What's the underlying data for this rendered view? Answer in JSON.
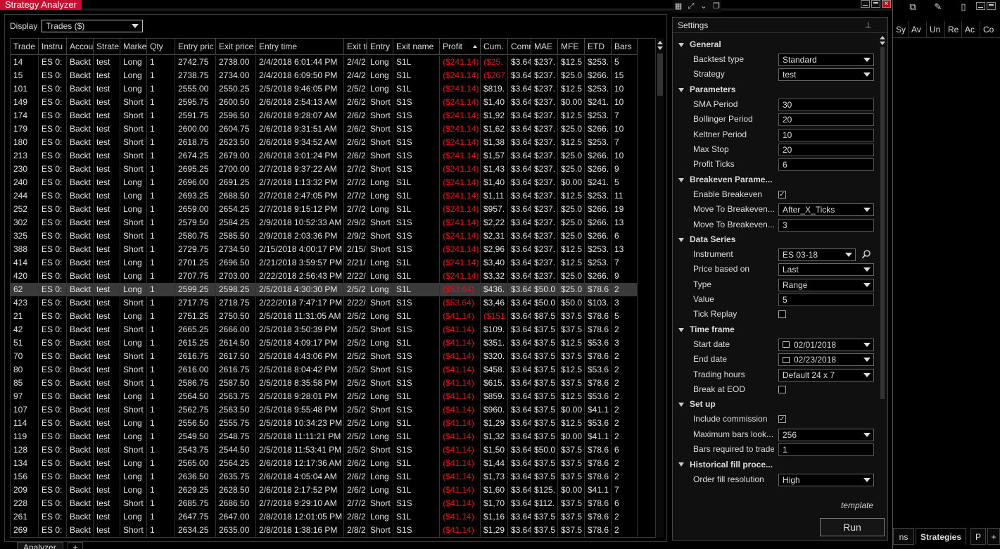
{
  "window": {
    "title": "Strategy Analyzer"
  },
  "display": {
    "label": "Display",
    "value": "Trades ($)"
  },
  "columns": [
    "Trade",
    "Instru",
    "Accou",
    "Strate",
    "Marke",
    "Qty",
    "Entry pric",
    "Exit price",
    "Entry time",
    "Exit ti",
    "Entry",
    "Exit name",
    "Profit",
    "Cum.",
    "Comr",
    "MAE",
    "MFE",
    "ETD",
    "Bars"
  ],
  "rows": [
    [
      "14",
      "ES 0:",
      "Backt",
      "test",
      "Long",
      "1",
      "2742.75",
      "2738.00",
      "2/4/2018 6:01:44 PM",
      "2/4/2",
      "Long",
      "S1L",
      "($241.14)",
      "($25.",
      "$3.64",
      "$237.",
      "$12.5",
      "$253.",
      "5"
    ],
    [
      "15",
      "ES 0:",
      "Backt",
      "test",
      "Long",
      "1",
      "2738.75",
      "2734.00",
      "2/4/2018 6:09:50 PM",
      "2/4/2",
      "Long",
      "S1L",
      "($241.14)",
      "($267",
      "$3.64",
      "$237.",
      "$25.0",
      "$266.",
      "15"
    ],
    [
      "101",
      "ES 0:",
      "Backt",
      "test",
      "Long",
      "1",
      "2555.00",
      "2550.25",
      "2/5/2018 9:46:05 PM",
      "2/5/2",
      "Long",
      "S1L",
      "($241.14)",
      "$819.",
      "$3.64",
      "$237.",
      "$12.5",
      "$253.",
      "10"
    ],
    [
      "149",
      "ES 0:",
      "Backt",
      "test",
      "Short",
      "1",
      "2595.75",
      "2600.50",
      "2/6/2018 2:54:13 AM",
      "2/6/2",
      "Short",
      "S1S",
      "($241.14)",
      "$1,40",
      "$3.64",
      "$237.",
      "$0.00",
      "$241.",
      "10"
    ],
    [
      "174",
      "ES 0:",
      "Backt",
      "test",
      "Short",
      "1",
      "2591.75",
      "2596.50",
      "2/6/2018 9:28:07 AM",
      "2/6/2",
      "Short",
      "S1S",
      "($241.14)",
      "$1,92",
      "$3.64",
      "$237.",
      "$12.5",
      "$253.",
      "7"
    ],
    [
      "179",
      "ES 0:",
      "Backt",
      "test",
      "Short",
      "1",
      "2600.00",
      "2604.75",
      "2/6/2018 9:31:51 AM",
      "2/6/2",
      "Short",
      "S1S",
      "($241.14)",
      "$1,62",
      "$3.64",
      "$237.",
      "$25.0",
      "$266.",
      "10"
    ],
    [
      "180",
      "ES 0:",
      "Backt",
      "test",
      "Short",
      "1",
      "2618.75",
      "2623.50",
      "2/6/2018 9:34:52 AM",
      "2/6/2",
      "Short",
      "S1S",
      "($241.14)",
      "$1,38",
      "$3.64",
      "$237.",
      "$12.5",
      "$253.",
      "7"
    ],
    [
      "213",
      "ES 0:",
      "Backt",
      "test",
      "Short",
      "1",
      "2674.25",
      "2679.00",
      "2/6/2018 3:01:24 PM",
      "2/6/2",
      "Short",
      "S1S",
      "($241.14)",
      "$1,57",
      "$3.64",
      "$237.",
      "$25.0",
      "$266.",
      "10"
    ],
    [
      "230",
      "ES 0:",
      "Backt",
      "test",
      "Short",
      "1",
      "2695.25",
      "2700.00",
      "2/7/2018 9:37:22 AM",
      "2/7/2",
      "Short",
      "S1S",
      "($241.14)",
      "$1,43",
      "$3.64",
      "$237.",
      "$25.0",
      "$266.",
      "9"
    ],
    [
      "240",
      "ES 0:",
      "Backt",
      "test",
      "Long",
      "1",
      "2696.00",
      "2691.25",
      "2/7/2018 1:13:32 PM",
      "2/7/2",
      "Long",
      "S1L",
      "($241.14)",
      "$1,40",
      "$3.64",
      "$237.",
      "$0.00",
      "$241.",
      "5"
    ],
    [
      "244",
      "ES 0:",
      "Backt",
      "test",
      "Long",
      "1",
      "2693.25",
      "2688.50",
      "2/7/2018 2:47:05 PM",
      "2/7/2",
      "Long",
      "S1L",
      "($241.14)",
      "$1,11",
      "$3.64",
      "$237.",
      "$12.5",
      "$253.",
      "11"
    ],
    [
      "252",
      "ES 0:",
      "Backt",
      "test",
      "Long",
      "1",
      "2659.00",
      "2654.25",
      "2/7/2018 9:15:12 PM",
      "2/7/2",
      "Long",
      "S1L",
      "($241.14)",
      "$957.",
      "$3.64",
      "$237.",
      "$25.0",
      "$266.",
      "19"
    ],
    [
      "302",
      "ES 0:",
      "Backt",
      "test",
      "Short",
      "1",
      "2579.50",
      "2584.25",
      "2/9/2018 10:52:33 AM",
      "2/9/2",
      "Short",
      "S1S",
      "($241.14)",
      "$2,22",
      "$3.64",
      "$237.",
      "$25.0",
      "$266.",
      "13"
    ],
    [
      "325",
      "ES 0:",
      "Backt",
      "test",
      "Short",
      "1",
      "2580.75",
      "2585.50",
      "2/9/2018 2:03:36 PM",
      "2/9/2",
      "Short",
      "S1S",
      "($241.14)",
      "$2,31",
      "$3.64",
      "$237.",
      "$25.0",
      "$266.",
      "6"
    ],
    [
      "388",
      "ES 0:",
      "Backt",
      "test",
      "Short",
      "1",
      "2729.75",
      "2734.50",
      "2/15/2018 4:00:17 PM",
      "2/15/",
      "Short",
      "S1S",
      "($241.14)",
      "$2,96",
      "$3.64",
      "$237.",
      "$12.5",
      "$253.",
      "13"
    ],
    [
      "414",
      "ES 0:",
      "Backt",
      "test",
      "Long",
      "1",
      "2701.25",
      "2696.50",
      "2/21/2018 3:59:57 PM",
      "2/21/",
      "Long",
      "S1L",
      "($241.14)",
      "$3,40",
      "$3.64",
      "$237.",
      "$12.5",
      "$253.",
      "7"
    ],
    [
      "420",
      "ES 0:",
      "Backt",
      "test",
      "Long",
      "1",
      "2707.75",
      "2703.00",
      "2/22/2018 2:56:43 PM",
      "2/22/",
      "Long",
      "S1L",
      "($241.14)",
      "$3,32",
      "$3.64",
      "$237.",
      "$25.0",
      "$266.",
      "9"
    ],
    [
      "62",
      "ES 0:",
      "Backt",
      "test",
      "Long",
      "1",
      "2599.25",
      "2598.25",
      "2/5/2018 4:30:30 PM",
      "2/5/2",
      "Long",
      "S1L",
      "($53.64)",
      "$436.",
      "$3.64",
      "$50.0",
      "$25.0",
      "$78.6",
      "2"
    ],
    [
      "423",
      "ES 0:",
      "Backt",
      "test",
      "Short",
      "1",
      "2717.75",
      "2718.75",
      "2/22/2018 7:47:17 PM",
      "2/22/",
      "Short",
      "S1S",
      "($53.64)",
      "$3,46",
      "$3.64",
      "$50.0",
      "$50.0",
      "$103.",
      "3"
    ],
    [
      "21",
      "ES 0:",
      "Backt",
      "test",
      "Long",
      "1",
      "2751.25",
      "2750.50",
      "2/5/2018 11:31:05 AM",
      "2/5/2",
      "Long",
      "S1L",
      "($41.14)",
      "($151",
      "$3.64",
      "$87.5",
      "$37.5",
      "$78.6",
      "5"
    ],
    [
      "42",
      "ES 0:",
      "Backt",
      "test",
      "Short",
      "1",
      "2665.25",
      "2666.00",
      "2/5/2018 3:50:39 PM",
      "2/5/2",
      "Short",
      "S1S",
      "($41.14)",
      "$109.",
      "$3.64",
      "$37.5",
      "$37.5",
      "$78.6",
      "2"
    ],
    [
      "51",
      "ES 0:",
      "Backt",
      "test",
      "Long",
      "1",
      "2615.25",
      "2614.50",
      "2/5/2018 4:09:17 PM",
      "2/5/2",
      "Long",
      "S1L",
      "($41.14)",
      "$351.",
      "$3.64",
      "$37.5",
      "$12.5",
      "$53.6",
      "3"
    ],
    [
      "70",
      "ES 0:",
      "Backt",
      "test",
      "Short",
      "1",
      "2616.75",
      "2617.50",
      "2/5/2018 4:43:06 PM",
      "2/5/2",
      "Short",
      "S1S",
      "($41.14)",
      "$320.",
      "$3.64",
      "$37.5",
      "$37.5",
      "$78.6",
      "2"
    ],
    [
      "80",
      "ES 0:",
      "Backt",
      "test",
      "Short",
      "1",
      "2616.00",
      "2616.75",
      "2/5/2018 8:04:42 PM",
      "2/5/2",
      "Short",
      "S1S",
      "($41.14)",
      "$458.",
      "$3.64",
      "$37.5",
      "$12.5",
      "$53.6",
      "2"
    ],
    [
      "85",
      "ES 0:",
      "Backt",
      "test",
      "Short",
      "1",
      "2586.75",
      "2587.50",
      "2/5/2018 8:35:58 PM",
      "2/5/2",
      "Short",
      "S1S",
      "($41.14)",
      "$615.",
      "$3.64",
      "$37.5",
      "$37.5",
      "$78.6",
      "2"
    ],
    [
      "97",
      "ES 0:",
      "Backt",
      "test",
      "Long",
      "1",
      "2564.50",
      "2563.75",
      "2/5/2018 9:28:01 PM",
      "2/5/2",
      "Long",
      "S1L",
      "($41.14)",
      "$859.",
      "$3.64",
      "$37.5",
      "$12.5",
      "$53.6",
      "2"
    ],
    [
      "107",
      "ES 0:",
      "Backt",
      "test",
      "Short",
      "1",
      "2562.75",
      "2563.50",
      "2/5/2018 9:55:48 PM",
      "2/5/2",
      "Short",
      "S1S",
      "($41.14)",
      "$960.",
      "$3.64",
      "$37.5",
      "$0.00",
      "$41.1",
      "2"
    ],
    [
      "114",
      "ES 0:",
      "Backt",
      "test",
      "Long",
      "1",
      "2556.50",
      "2555.75",
      "2/5/2018 10:34:23 PM",
      "2/5/2",
      "Long",
      "S1L",
      "($41.14)",
      "$1,29",
      "$3.64",
      "$37.5",
      "$12.5",
      "$53.6",
      "2"
    ],
    [
      "119",
      "ES 0:",
      "Backt",
      "test",
      "Long",
      "1",
      "2549.50",
      "2548.75",
      "2/5/2018 11:11:21 PM",
      "2/5/2",
      "Long",
      "S1L",
      "($41.14)",
      "$1,32",
      "$3.64",
      "$37.5",
      "$0.00",
      "$41.1",
      "2"
    ],
    [
      "128",
      "ES 0:",
      "Backt",
      "test",
      "Short",
      "1",
      "2543.75",
      "2544.50",
      "2/5/2018 11:53:41 PM",
      "2/5/2",
      "Short",
      "S1S",
      "($41.14)",
      "$1,50",
      "$3.64",
      "$50.0",
      "$37.5",
      "$78.6",
      "6"
    ],
    [
      "134",
      "ES 0:",
      "Backt",
      "test",
      "Long",
      "1",
      "2565.00",
      "2564.25",
      "2/6/2018 12:17:36 AM",
      "2/6/2",
      "Long",
      "S1L",
      "($41.14)",
      "$1,44",
      "$3.64",
      "$37.5",
      "$37.5",
      "$78.6",
      "2"
    ],
    [
      "156",
      "ES 0:",
      "Backt",
      "test",
      "Long",
      "1",
      "2636.50",
      "2635.75",
      "2/6/2018 4:05:04 AM",
      "2/6/2",
      "Long",
      "S1L",
      "($41.14)",
      "$1,73",
      "$3.64",
      "$37.5",
      "$37.5",
      "$78.6",
      "2"
    ],
    [
      "209",
      "ES 0:",
      "Backt",
      "test",
      "Long",
      "1",
      "2629.25",
      "2628.50",
      "2/6/2018 2:17:52 PM",
      "2/6/2",
      "Long",
      "S1L",
      "($41.14)",
      "$1,60",
      "$3.64",
      "$125.",
      "$0.00",
      "$41.1",
      "7"
    ],
    [
      "228",
      "ES 0:",
      "Backt",
      "test",
      "Short",
      "1",
      "2685.75",
      "2686.50",
      "2/7/2018 9:29:10 AM",
      "2/7/2",
      "Short",
      "S1S",
      "($41.14)",
      "$1,70",
      "$3.64",
      "$112.",
      "$37.5",
      "$78.6",
      "6"
    ],
    [
      "261",
      "ES 0:",
      "Backt",
      "test",
      "Long",
      "1",
      "2647.75",
      "2647.00",
      "2/8/2018 12:01:05 PM",
      "2/8/2",
      "Long",
      "S1L",
      "($41.14)",
      "$1,16",
      "$3.64",
      "$37.5",
      "$37.5",
      "$78.6",
      "2"
    ],
    [
      "269",
      "ES 0:",
      "Backt",
      "test",
      "Short",
      "1",
      "2634.25",
      "2635.00",
      "2/8/2018 1:38:16 PM",
      "2/8/2",
      "Short",
      "S1S",
      "($41.14)",
      "$1,29",
      "$3.64",
      "$37.5",
      "$37.5",
      "$78.6",
      "2"
    ]
  ],
  "selected_row": 17,
  "bottom_tab": {
    "label": "Analyzer",
    "add": "+"
  },
  "settings": {
    "title": "Settings",
    "template_label": "template",
    "run_label": "Run",
    "sections": [
      {
        "title": "General",
        "props": [
          {
            "label": "Backtest type",
            "type": "dropdown",
            "value": "Standard"
          },
          {
            "label": "Strategy",
            "type": "dropdown",
            "value": "test"
          }
        ]
      },
      {
        "title": "Parameters",
        "props": [
          {
            "label": "SMA Period",
            "type": "text",
            "value": "30"
          },
          {
            "label": "Bollinger Period",
            "type": "text",
            "value": "20"
          },
          {
            "label": "Keltner Period",
            "type": "text",
            "value": "10"
          },
          {
            "label": "Max Stop",
            "type": "text",
            "value": "20"
          },
          {
            "label": "Profit Ticks",
            "type": "text",
            "value": "6"
          }
        ]
      },
      {
        "title": "Breakeven Parame...",
        "props": [
          {
            "label": "Enable Breakeven",
            "type": "check",
            "value": "✓"
          },
          {
            "label": "Move To Breakeven...",
            "type": "dropdown",
            "value": "After_X_Ticks"
          },
          {
            "label": "Move To Breakeven...",
            "type": "text",
            "value": "3"
          }
        ]
      },
      {
        "title": "Data Series",
        "props": [
          {
            "label": "Instrument",
            "type": "instrument",
            "value": "ES 03-18"
          },
          {
            "label": "Price based on",
            "type": "dropdown",
            "value": "Last"
          },
          {
            "label": "Type",
            "type": "dropdown",
            "value": "Range"
          },
          {
            "label": "Value",
            "type": "text",
            "value": "5"
          },
          {
            "label": "Tick Replay",
            "type": "check",
            "value": ""
          }
        ]
      },
      {
        "title": "Time frame",
        "props": [
          {
            "label": "Start date",
            "type": "date",
            "value": "02/01/2018"
          },
          {
            "label": "End date",
            "type": "date",
            "value": "02/23/2018"
          },
          {
            "label": "Trading hours",
            "type": "dropdown",
            "value": "Default 24 x 7"
          },
          {
            "label": "Break at EOD",
            "type": "check",
            "value": ""
          }
        ]
      },
      {
        "title": "Set up",
        "props": [
          {
            "label": "Include commission",
            "type": "check",
            "value": "✓"
          },
          {
            "label": "Maximum bars look...",
            "type": "dropdown",
            "value": "256"
          },
          {
            "label": "Bars required to trade",
            "type": "text",
            "value": "1"
          }
        ]
      },
      {
        "title": "Historical fill proce...",
        "props": [
          {
            "label": "Order fill resolution",
            "type": "dropdown",
            "value": "High"
          }
        ]
      }
    ]
  },
  "right_panel": {
    "columns": [
      "Sy",
      "Av",
      "Un",
      "Re",
      "Ac",
      "Co"
    ],
    "tabs": [
      "ns",
      "Strategies",
      "P"
    ],
    "add": "+"
  },
  "colors": {
    "title_bg": "#c8102e",
    "negative": "#e0101c",
    "selected_row": "#3a3a3a"
  }
}
